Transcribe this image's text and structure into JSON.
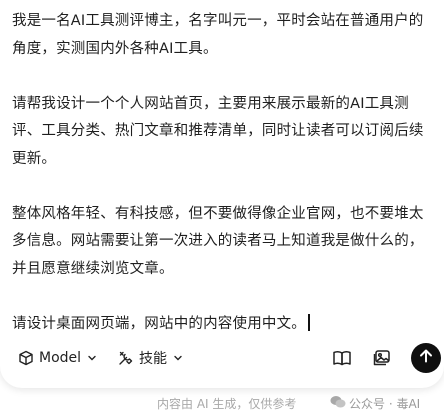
{
  "prompt": {
    "paragraphs": [
      "我是一名AI工具测评博主，名字叫元一，平时会站在普通用户的角度，实测国内外各种AI工具。",
      "请帮我设计一个个人网站首页，主要用来展示最新的AI工具测评、工具分类、热门文章和推荐清单，同时让读者可以订阅后续更新。",
      "整体风格年轻、有科技感，但不要做得像企业官网，也不要堆太多信息。网站需要让第一次进入的读者马上知道我是做什么的，并且愿意继续浏览文章。",
      "请设计桌面网页端，网站中的内容使用中文。"
    ]
  },
  "toolbar": {
    "model_label": "Model",
    "skills_label": "技能",
    "icons": {
      "model": "cube-icon",
      "skills": "tools-icon",
      "book": "book-open-icon",
      "image": "image-upload-icon",
      "send": "arrow-up-icon"
    }
  },
  "footer": {
    "disclaimer": "内容由 AI 生成，仅供参考",
    "watermark": "公众号 · 毒AI"
  },
  "colors": {
    "send_button": "#0f0f0f",
    "text": "#1f1f1f",
    "muted": "#a8a8a8"
  }
}
